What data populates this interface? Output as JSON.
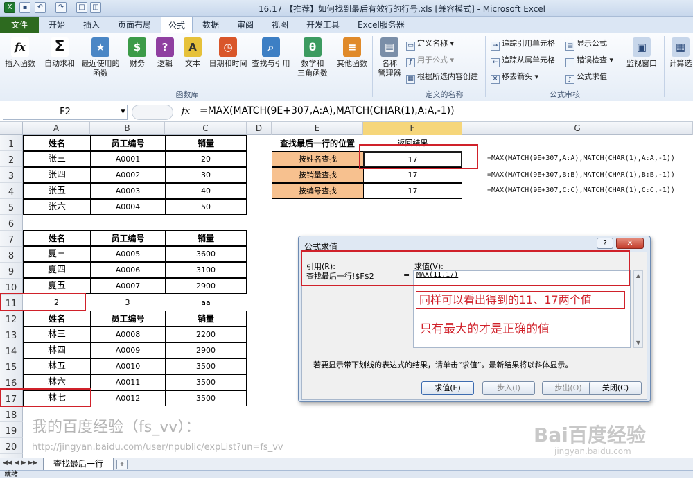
{
  "window": {
    "title": "16.17 【推荐】如何找到最后有效行的行号.xls [兼容模式] - Microsoft Excel"
  },
  "ribbon_tabs": [
    "文件",
    "开始",
    "插入",
    "页面布局",
    "公式",
    "数据",
    "审阅",
    "视图",
    "开发工具",
    "Excel服务器"
  ],
  "ribbon": {
    "insert_function": "插入函数",
    "autosum": "自动求和",
    "recent": "最近使用的\n函数",
    "finance": "财务",
    "logic": "逻辑",
    "text": "文本",
    "datetime": "日期和时间",
    "lookup": "查找与引用",
    "math": "数学和\n三角函数",
    "other": "其他函数",
    "group_library": "函数库",
    "name_manager": "名称\n管理器",
    "define_name": "定义名称",
    "use_in_formula": "用于公式",
    "create_from_sel": "根据所选内容创建",
    "group_names": "定义的名称",
    "trace_prec": "追踪引用单元格",
    "trace_dep": "追踪从属单元格",
    "remove_arrows": "移去箭头",
    "show_formulas": "显示公式",
    "error_check": "错误检查",
    "eval_formula": "公式求值",
    "group_audit": "公式审核",
    "watch": "监视窗口",
    "calc": "计算选"
  },
  "formula_bar": {
    "name_box": "F2",
    "fx": "fx",
    "formula": "=MAX(MATCH(9E+307,A:A),MATCH(CHAR(1),A:A,-1))"
  },
  "columns": [
    "A",
    "B",
    "C",
    "D",
    "E",
    "F",
    "G"
  ],
  "rows": [
    "1",
    "2",
    "3",
    "4",
    "5",
    "6",
    "7",
    "8",
    "9",
    "10",
    "11",
    "12",
    "13",
    "14",
    "15",
    "16",
    "17",
    "18",
    "19",
    "20",
    "21"
  ],
  "table1": {
    "headers": [
      "姓名",
      "员工编号",
      "销量"
    ],
    "rows": [
      [
        "张三",
        "A0001",
        "20"
      ],
      [
        "张四",
        "A0002",
        "30"
      ],
      [
        "张五",
        "A0003",
        "40"
      ],
      [
        "张六",
        "A0004",
        "50"
      ]
    ]
  },
  "table2": {
    "headers": [
      "姓名",
      "员工编号",
      "销量"
    ],
    "rows": [
      [
        "夏三",
        "A0005",
        "3600"
      ],
      [
        "夏四",
        "A0006",
        "3100"
      ],
      [
        "夏五",
        "A0007",
        "2900"
      ]
    ]
  },
  "row11": [
    "2",
    "3",
    "aa"
  ],
  "table3": {
    "headers": [
      "姓名",
      "员工编号",
      "销量"
    ],
    "rows": [
      [
        "林三",
        "A0008",
        "2200"
      ],
      [
        "林四",
        "A0009",
        "2900"
      ],
      [
        "林五",
        "A0010",
        "3500"
      ],
      [
        "林六",
        "A0011",
        "3500"
      ],
      [
        "林七",
        "A0012",
        "3500"
      ]
    ]
  },
  "lookup": {
    "header_left": "查找最后一行的位置",
    "header_right": "返回结果",
    "rows": [
      {
        "label": "按姓名查找",
        "value": "17",
        "formula": "=MAX(MATCH(9E+307,A:A),MATCH(CHAR(1),A:A,-1))"
      },
      {
        "label": "按销量查找",
        "value": "17",
        "formula": "=MAX(MATCH(9E+307,B:B),MATCH(CHAR(1),B:B,-1))"
      },
      {
        "label": "按编号查找",
        "value": "17",
        "formula": "=MAX(MATCH(9E+307,C:C),MATCH(CHAR(1),C:C,-1))"
      }
    ]
  },
  "dialog": {
    "title": "公式求值",
    "ref_label": "引用(R):",
    "ref_value": "查找最后一行!$F$2",
    "eq": "=",
    "eval_label": "求值(V):",
    "eval_value": "MAX(11,17)",
    "note1": "同样可以看出得到的11、17两个值",
    "note2": "只有最大的才是正确的值",
    "hint": "若要显示带下划线的表达式的结果，请单击“求值”。最新结果将以斜体显示。",
    "btn_eval": "求值(E)",
    "btn_stepin": "步入(I)",
    "btn_stepout": "步出(O)",
    "btn_close": "关闭(C)"
  },
  "watermark": {
    "line1": "我的百度经验（fs_vv）：",
    "line2": "http://jingyan.baidu.com/user/npublic/expList?un=fs_vv",
    "brand": "Bai百度经验",
    "brand_url": "jingyan.baidu.com"
  },
  "sheet_tab": "查找最后一行",
  "status": "就绪"
}
